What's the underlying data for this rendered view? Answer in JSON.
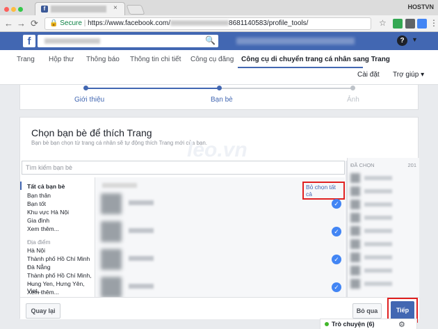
{
  "browser": {
    "profile_name": "HOSTVN",
    "tab_close": "×",
    "url_secure": "Secure",
    "url_prefix": "https://www.facebook.com/",
    "url_suffix": "8681140583/profile_tools/",
    "nav_back": "←",
    "nav_forward": "→",
    "nav_reload": "⟳",
    "star": "☆"
  },
  "fb": {
    "logo": "f",
    "help_icon": "?",
    "caret": "▼",
    "search_icon": "🔍"
  },
  "page_tabs": [
    {
      "label": "Trang"
    },
    {
      "label": "Hộp thư"
    },
    {
      "label": "Thông báo"
    },
    {
      "label": "Thông tin chi tiết"
    },
    {
      "label": "Công cụ đăng"
    },
    {
      "label": "Công cụ di chuyển trang cá nhân sang Trang"
    }
  ],
  "page_links": {
    "settings": "Cài đặt",
    "help": "Trợ giúp ▾"
  },
  "progress": {
    "steps": [
      "Giới thiệu",
      "Bạn bè",
      "Ảnh"
    ]
  },
  "main": {
    "title": "Chọn bạn bè để thích Trang",
    "subtitle": "Bạn bè bạn chọn từ trang cá nhân sẽ tự động thích Trang mới của bạn.",
    "search_placeholder": "Tìm kiếm bạn bè",
    "watermark": "leo.vn",
    "deselect_all": "Bỏ chọn tất cả",
    "check_mark": "✓",
    "categories": [
      {
        "label": "Tất cả bạn bè"
      },
      {
        "label": "Bạn thân"
      },
      {
        "label": "Bạn tốt"
      },
      {
        "label": "Khu vực Hà Nội"
      },
      {
        "label": "Gia đình"
      },
      {
        "label": "Xem thêm..."
      },
      {
        "label": "Địa điểm"
      },
      {
        "label": "Hà Nội"
      },
      {
        "label": "Thành phố Hồ Chí Minh"
      },
      {
        "label": "Đà Nẵng"
      },
      {
        "label": "Thành phố Hồ Chí Minh, ..."
      },
      {
        "label": "Hung Yen, Hưng Yên, Viet..."
      },
      {
        "label": "Xem thêm..."
      }
    ],
    "selected_header": "ĐÃ CHỌN",
    "selected_count": "201"
  },
  "footer": {
    "back": "Quay lại",
    "skip": "Bỏ qua",
    "next": "Tiếp"
  },
  "chat": {
    "label": "Trò chuyện (6)",
    "gear": "⚙"
  },
  "colors": {
    "fb_blue": "#4267b2",
    "highlight": "#e02020",
    "check": "#4285f4"
  }
}
